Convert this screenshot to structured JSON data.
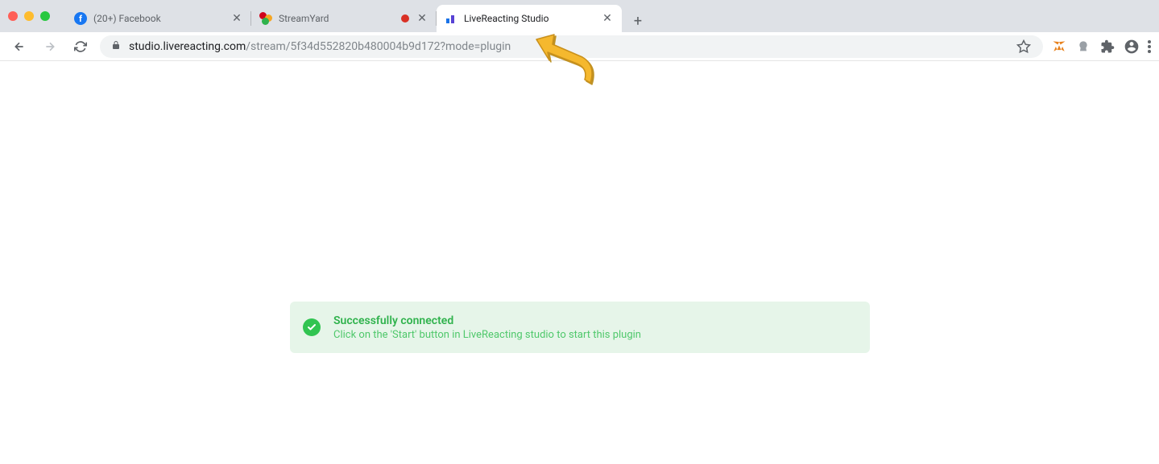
{
  "tabs": [
    {
      "title": "(20+) Facebook",
      "active": false,
      "recording": false
    },
    {
      "title": "StreamYard",
      "active": false,
      "recording": true
    },
    {
      "title": "LiveReacting Studio",
      "active": true,
      "recording": false
    }
  ],
  "url": {
    "domain": "studio.livereacting.com",
    "path": "/stream/5f34d552820b480004b9d172?mode=plugin"
  },
  "alert": {
    "title": "Successfully connected",
    "description": "Click on the 'Start' button in LiveReacting studio to start this plugin"
  }
}
